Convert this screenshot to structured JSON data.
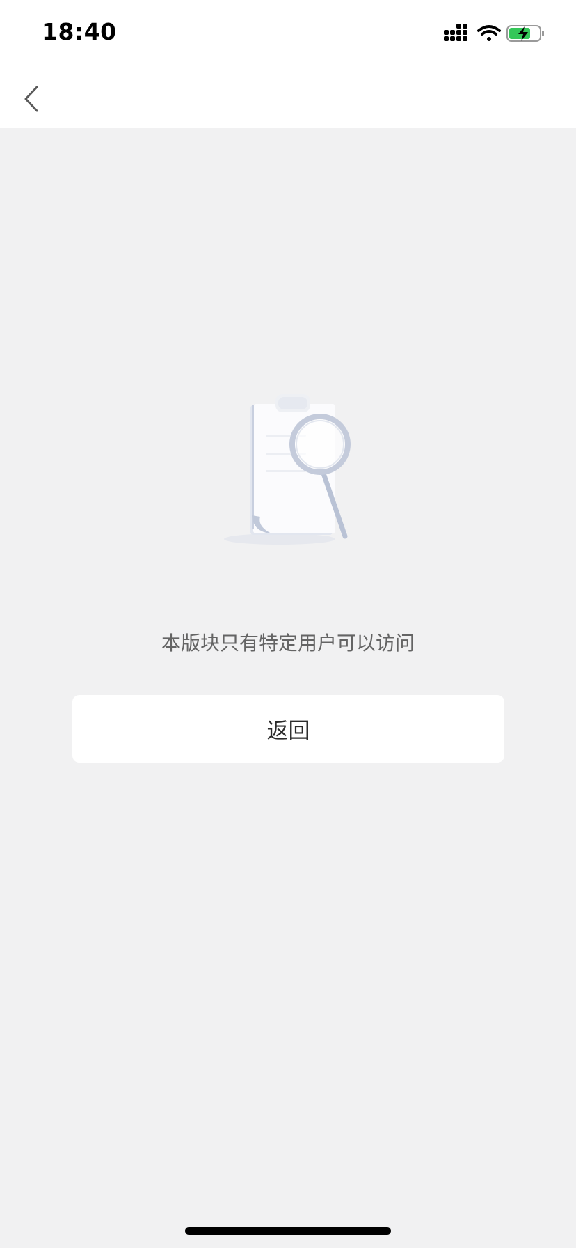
{
  "status_bar": {
    "time": "18:40",
    "signal_icon": "cellular-signal-icon",
    "wifi_icon": "wifi-icon",
    "battery_icon": "battery-charging-icon",
    "battery_color": "#34c759"
  },
  "nav": {
    "back_icon": "chevron-left-icon"
  },
  "empty_state": {
    "illustration_icon": "document-search-icon",
    "message": "本版块只有特定用户可以访问",
    "return_label": "返回"
  },
  "colors": {
    "background": "#f1f1f2",
    "surface": "#ffffff",
    "message_text": "#646464",
    "button_text": "#2b2b2b"
  }
}
